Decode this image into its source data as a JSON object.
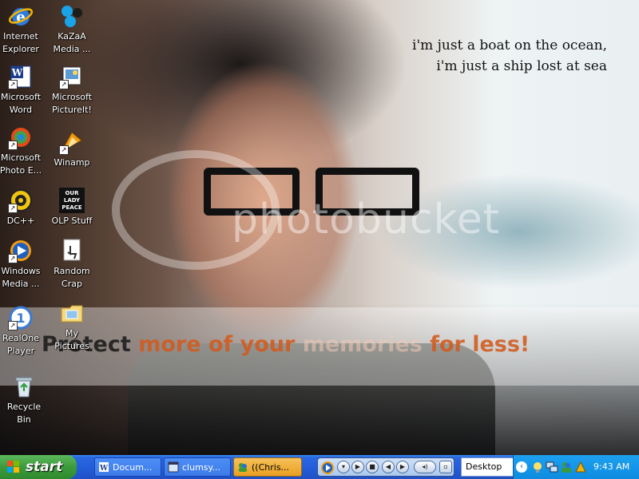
{
  "wallpaper": {
    "lyrics": [
      "i'm just a boat on the ocean,",
      "i'm just a ship lost at sea"
    ],
    "watermark": "photobucket",
    "banner": {
      "part1": "Protect",
      "part2": "more of your",
      "part3": "memories",
      "part4": "for less!"
    }
  },
  "desktop_icons": [
    {
      "label_line1": "Internet",
      "label_line2": "Explorer",
      "icon": "internet-explorer-icon"
    },
    {
      "label_line1": "KaZaA",
      "label_line2": "Media ...",
      "icon": "kazaa-icon"
    },
    {
      "label_line1": "Microsoft",
      "label_line2": "Word",
      "icon": "word-icon"
    },
    {
      "label_line1": "Microsoft",
      "label_line2": "PictureIt!",
      "icon": "pictureit-icon"
    },
    {
      "label_line1": "Microsoft",
      "label_line2": "Photo E...",
      "icon": "photo-editor-icon"
    },
    {
      "label_line1": "Winamp",
      "label_line2": "",
      "icon": "winamp-icon"
    },
    {
      "label_line1": "DC++",
      "label_line2": "",
      "icon": "dcpp-icon"
    },
    {
      "label_line1": "OLP Stuff",
      "label_line2": "",
      "icon": "olp-folder-icon",
      "badge": "OUR LADY PEACE"
    },
    {
      "label_line1": "Windows",
      "label_line2": "Media ...",
      "icon": "windows-media-icon"
    },
    {
      "label_line1": "Random",
      "label_line2": "Crap",
      "icon": "random-crap-icon"
    },
    {
      "label_line1": "RealOne",
      "label_line2": "Player",
      "icon": "realone-icon"
    },
    {
      "label_line1": "My",
      "label_line2": "Pictures",
      "icon": "my-pictures-icon"
    },
    {
      "label_line1": "Recycle",
      "label_line2": "Bin",
      "icon": "recycle-bin-icon"
    }
  ],
  "taskbar": {
    "start_label": "start",
    "tasks": [
      {
        "label": "Docum...",
        "icon": "word-doc-icon",
        "active": false
      },
      {
        "label": "clumsy...",
        "icon": "browser-icon",
        "active": false
      },
      {
        "label": "((Chris...",
        "icon": "messenger-icon",
        "active": true
      }
    ],
    "media_player": {
      "icon": "media-player-icon"
    },
    "deskbar_label": "Desktop",
    "tray_icons": [
      "chevron-left-icon",
      "bulb-icon",
      "network-icon",
      "messenger-tray-icon",
      "updates-icon"
    ],
    "clock": "9:43 AM"
  },
  "colors": {
    "taskbar_blue": "#245edb",
    "start_green": "#3c9a3c",
    "tray_blue": "#0d8ce0",
    "active_task": "#f0b030"
  }
}
